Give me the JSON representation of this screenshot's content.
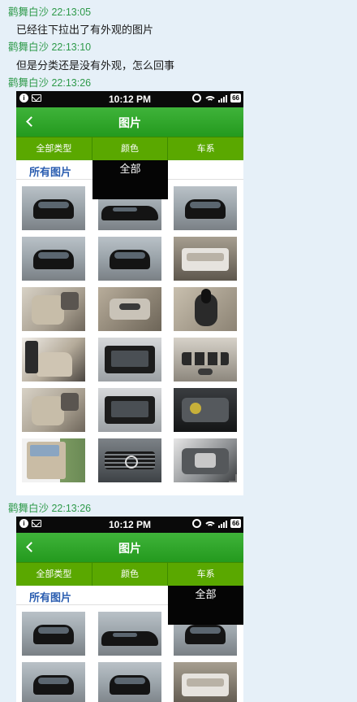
{
  "messages": [
    {
      "header": "鹳舞白沙 22:13:05",
      "text": "已经往下拉出了有外观的图片"
    },
    {
      "header": "鹳舞白沙 22:13:10",
      "text": "但是分类还是没有外观，怎么回事"
    },
    {
      "header": "鹳舞白沙 22:13:26"
    },
    {
      "header": "鹳舞白沙 22:13:26"
    }
  ],
  "screenshots": [
    {
      "status_time": "10:12 PM",
      "battery": "66",
      "title": "图片",
      "tabs": [
        "全部类型",
        "颜色",
        "车系"
      ],
      "subtitle": "所有图片",
      "dropdown_item": "全部",
      "dropdown_under_tab": "颜色"
    },
    {
      "status_time": "10:12 PM",
      "battery": "66",
      "title": "图片",
      "tabs": [
        "全部类型",
        "颜色",
        "车系"
      ],
      "subtitle": "所有图片",
      "dropdown_item": "全部",
      "dropdown_under_tab": "车系"
    }
  ],
  "thumbnail_grid": [
    [
      "exterior-front-photo",
      "exterior-side-photo",
      "exterior-front-photo"
    ],
    [
      "exterior-front-photo",
      "exterior-front-photo",
      "trunk-photo"
    ],
    [
      "interior-seat-photo",
      "seat-control-photo",
      "gear-shifter-photo"
    ],
    [
      "cabin-photo",
      "console-photo",
      "center-controls-photo"
    ],
    [
      "rear-seat-photo",
      "dashboard-screen-photo",
      "engine-photo"
    ],
    [
      "open-door-photo",
      "front-grille-photo",
      "engine-bay-photo"
    ]
  ]
}
